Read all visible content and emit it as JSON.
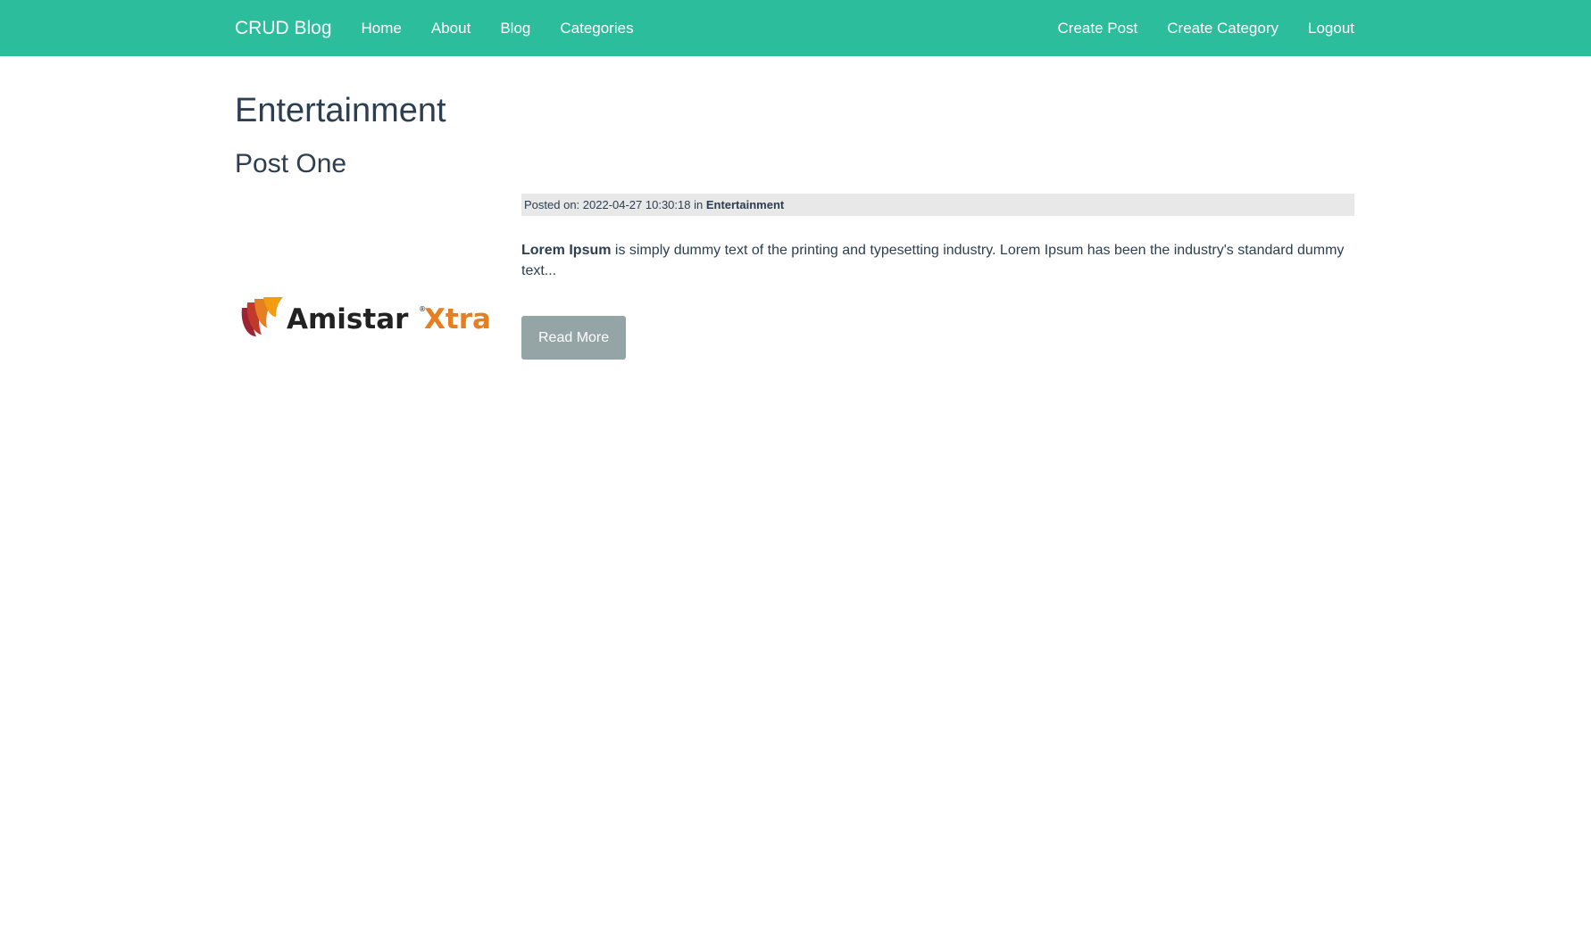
{
  "navbar": {
    "brand": "CRUD Blog",
    "left_links": [
      "Home",
      "About",
      "Blog",
      "Categories"
    ],
    "right_links": [
      "Create Post",
      "Create Category",
      "Logout"
    ],
    "background_color": "#2bbd9c"
  },
  "page": {
    "category_title": "Entertainment"
  },
  "post": {
    "title": "Post One",
    "meta_prefix": "Posted on: 2022-04-27 10:30:18 in ",
    "meta_category": "Entertainment",
    "excerpt_bold": "Lorem Ipsum",
    "excerpt_rest": " is simply dummy text of the printing and typesetting industry. Lorem Ipsum has been the industry's standard dummy text...",
    "read_more_label": "Read More",
    "image": {
      "logo_word_1": "Amistar",
      "logo_registered": "®",
      "logo_word_2": "Xtra"
    }
  }
}
